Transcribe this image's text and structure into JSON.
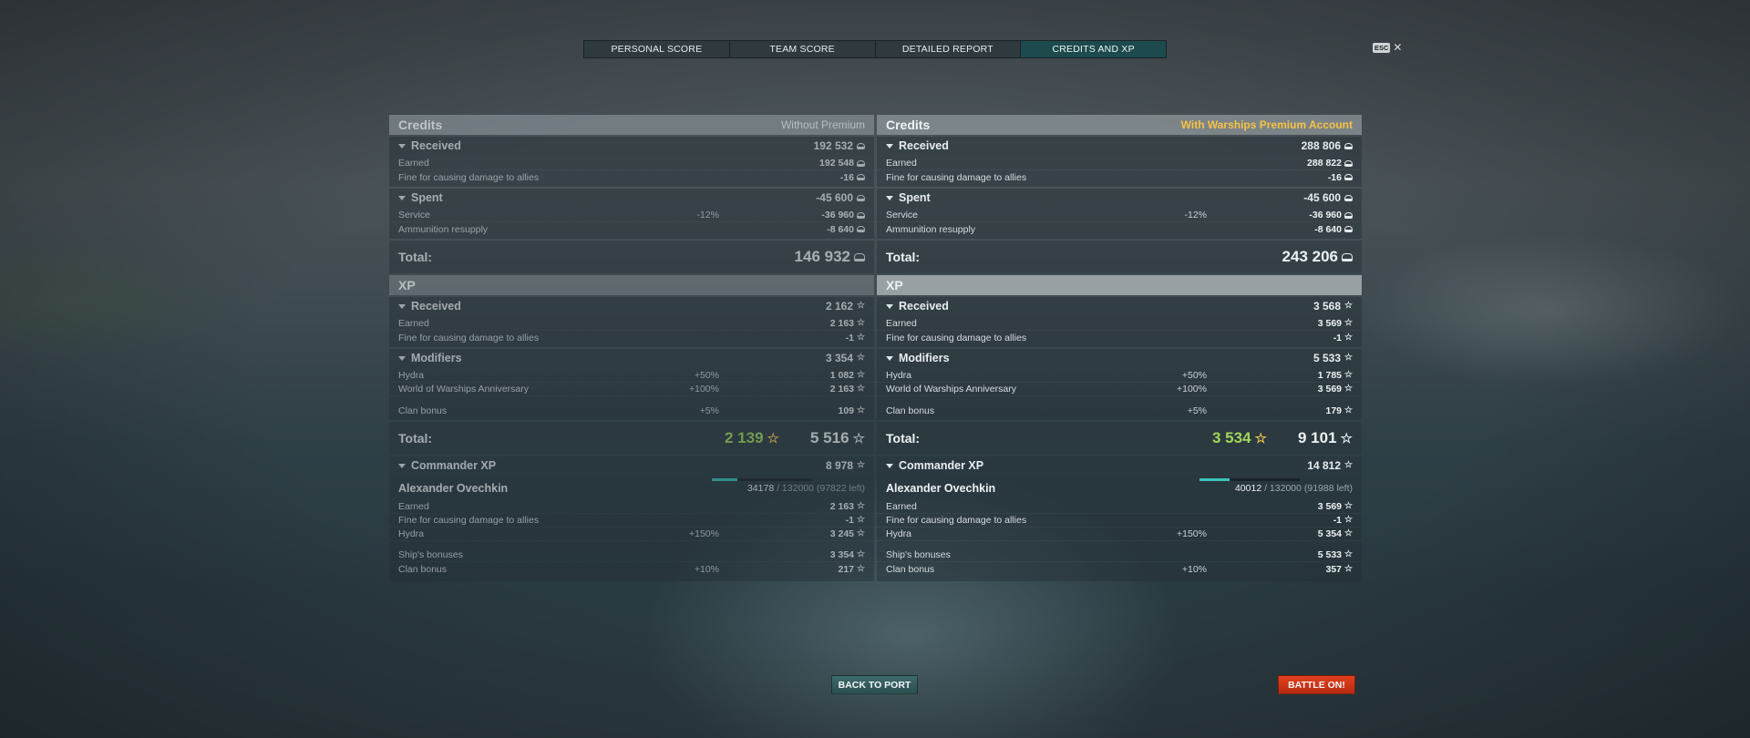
{
  "tabs": [
    "Personal Score",
    "Team Score",
    "Detailed Report",
    "Credits and XP"
  ],
  "active_tab": 3,
  "esc": {
    "key": "ESC",
    "close": "✕"
  },
  "left": {
    "credits_title": "Credits",
    "credits_mode": "Without Premium",
    "received": {
      "label": "Received",
      "value": "192 532"
    },
    "received_rows": [
      {
        "label": "Earned",
        "pct": "",
        "value": "192 548"
      },
      {
        "label": "Fine for causing damage to allies",
        "pct": "",
        "value": "-16"
      }
    ],
    "spent": {
      "label": "Spent",
      "value": "-45 600"
    },
    "spent_rows": [
      {
        "label": "Service",
        "pct": "-12%",
        "value": "-36 960"
      },
      {
        "label": "Ammunition resupply",
        "pct": "",
        "value": "-8 640"
      }
    ],
    "credits_total": {
      "label": "Total:",
      "value": "146 932"
    },
    "xp_title": "XP",
    "xp_received": {
      "label": "Received",
      "value": "2 162"
    },
    "xp_received_rows": [
      {
        "label": "Earned",
        "pct": "",
        "value": "2 163"
      },
      {
        "label": "Fine for causing damage to allies",
        "pct": "",
        "value": "-1"
      }
    ],
    "modifiers": {
      "label": "Modifiers",
      "value": "3 354"
    },
    "modifier_rows": [
      {
        "label": "Hydra",
        "pct": "+50%",
        "value": "1 082"
      },
      {
        "label": "World of Warships Anniversary",
        "pct": "+100%",
        "value": "2 163"
      },
      {
        "label": "Clan bonus",
        "pct": "+5%",
        "value": "109"
      }
    ],
    "xp_total": {
      "label": "Total:",
      "free": "2 139",
      "value": "5 516"
    },
    "commander": {
      "label": "Commander XP",
      "value": "8 978"
    },
    "commander_name": "Alexander Ovechkin",
    "commander_progress": {
      "current": "34178",
      "rest": " / 132000 (97822 left)",
      "fraction": 0.259
    },
    "commander_rows": [
      {
        "label": "Earned",
        "pct": "",
        "value": "2 163"
      },
      {
        "label": "Fine for causing damage to allies",
        "pct": "",
        "value": "-1"
      },
      {
        "label": "Hydra",
        "pct": "+150%",
        "value": "3 245"
      },
      {
        "label": "Ship's bonuses",
        "pct": "",
        "value": "3 354"
      },
      {
        "label": "Clan bonus",
        "pct": "+10%",
        "value": "217"
      }
    ]
  },
  "right": {
    "credits_title": "Credits",
    "credits_mode": "With Warships Premium Account",
    "received": {
      "label": "Received",
      "value": "288 806"
    },
    "received_rows": [
      {
        "label": "Earned",
        "pct": "",
        "value": "288 822"
      },
      {
        "label": "Fine for causing damage to allies",
        "pct": "",
        "value": "-16"
      }
    ],
    "spent": {
      "label": "Spent",
      "value": "-45 600"
    },
    "spent_rows": [
      {
        "label": "Service",
        "pct": "-12%",
        "value": "-36 960"
      },
      {
        "label": "Ammunition resupply",
        "pct": "",
        "value": "-8 640"
      }
    ],
    "credits_total": {
      "label": "Total:",
      "value": "243 206"
    },
    "xp_title": "XP",
    "xp_received": {
      "label": "Received",
      "value": "3 568"
    },
    "xp_received_rows": [
      {
        "label": "Earned",
        "pct": "",
        "value": "3 569"
      },
      {
        "label": "Fine for causing damage to allies",
        "pct": "",
        "value": "-1"
      }
    ],
    "modifiers": {
      "label": "Modifiers",
      "value": "5 533"
    },
    "modifier_rows": [
      {
        "label": "Hydra",
        "pct": "+50%",
        "value": "1 785"
      },
      {
        "label": "World of Warships Anniversary",
        "pct": "+100%",
        "value": "3 569"
      },
      {
        "label": "Clan bonus",
        "pct": "+5%",
        "value": "179"
      }
    ],
    "xp_total": {
      "label": "Total:",
      "free": "3 534",
      "value": "9 101"
    },
    "commander": {
      "label": "Commander XP",
      "value": "14 812"
    },
    "commander_name": "Alexander Ovechkin",
    "commander_progress": {
      "current": "40012",
      "rest": " / 132000 (91988 left)",
      "fraction": 0.303
    },
    "commander_rows": [
      {
        "label": "Earned",
        "pct": "",
        "value": "3 569"
      },
      {
        "label": "Fine for causing damage to allies",
        "pct": "",
        "value": "-1"
      },
      {
        "label": "Hydra",
        "pct": "+150%",
        "value": "5 354"
      },
      {
        "label": "Ship's bonuses",
        "pct": "",
        "value": "5 533"
      },
      {
        "label": "Clan bonus",
        "pct": "+10%",
        "value": "357"
      }
    ]
  },
  "buttons": {
    "back": "Back to port",
    "battle": "Battle on!"
  },
  "colors": {
    "active_tab": "#1c4a4d",
    "premium_gold": "#f6c245",
    "free_xp_green": "#a3d65a",
    "battle_red": "#d8391a",
    "progress_teal": "#38c5b8"
  }
}
